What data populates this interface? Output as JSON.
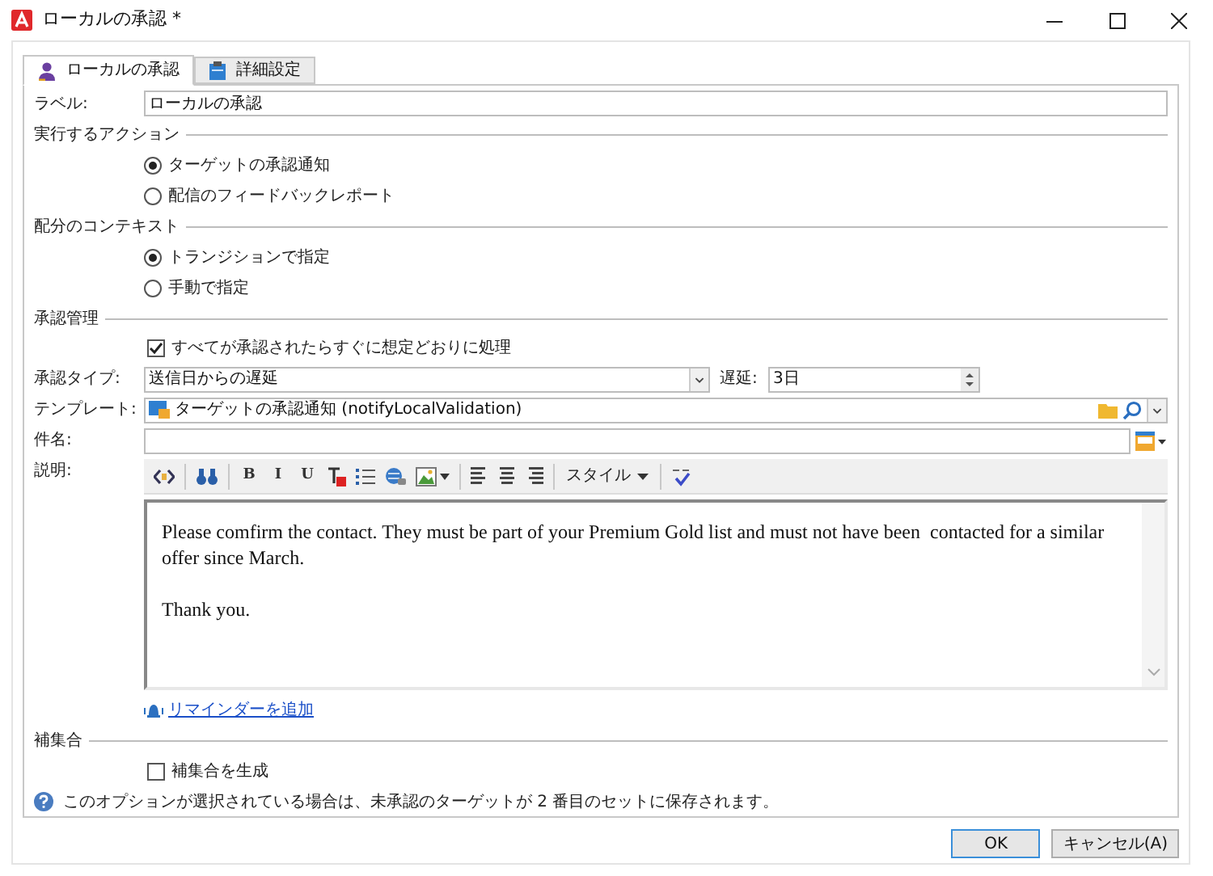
{
  "window": {
    "title": "ローカルの承認 *"
  },
  "tabs": [
    {
      "label": "ローカルの承認",
      "selected": true,
      "kind": "person"
    },
    {
      "label": "詳細設定",
      "selected": false,
      "kind": "clipboard"
    }
  ],
  "label_field": {
    "label": "ラベル:",
    "value": "ローカルの承認"
  },
  "action_section": {
    "title": "実行するアクション",
    "options": [
      {
        "label": "ターゲットの承認通知",
        "selected": true
      },
      {
        "label": "配信のフィードバックレポート",
        "selected": false
      }
    ]
  },
  "context_section": {
    "title": "配分のコンテキスト",
    "options": [
      {
        "label": "トランジションで指定",
        "selected": true
      },
      {
        "label": "手動で指定",
        "selected": false
      }
    ]
  },
  "approval_section": {
    "title": "承認管理",
    "auto_process": {
      "label": "すべてが承認されたらすぐに想定どおりに処理",
      "checked": true
    },
    "approval_type": {
      "label": "承認タイプ:",
      "value": "送信日からの遅延"
    },
    "delay": {
      "label": "遅延:",
      "value": "3日"
    },
    "template": {
      "label": "テンプレート:",
      "value": "ターゲットの承認通知 (notifyLocalValidation)"
    },
    "subject": {
      "label": "件名:"
    },
    "description": {
      "label": "説明:",
      "toolbar": [
        {
          "kind": "source"
        },
        {
          "kind": "separator"
        },
        {
          "kind": "find"
        },
        {
          "kind": "separator"
        },
        {
          "kind": "text",
          "text": "B"
        },
        {
          "kind": "text",
          "text": "I"
        },
        {
          "kind": "text",
          "text": "U"
        },
        {
          "kind": "clearformat"
        },
        {
          "kind": "list"
        },
        {
          "kind": "link"
        },
        {
          "kind": "image"
        },
        {
          "kind": "separator"
        },
        {
          "kind": "alignleft"
        },
        {
          "kind": "aligncenter"
        },
        {
          "kind": "alignright"
        },
        {
          "kind": "separator"
        },
        {
          "kind": "dropdown",
          "text": "スタイル"
        },
        {
          "kind": "separator"
        },
        {
          "kind": "spellcheck"
        }
      ],
      "paragraphs": [
        "Please comfirm the contact. They must be part of your Premium Gold list and must not have been  contacted for a similar offer since March.",
        "Thank you."
      ]
    },
    "reminder_link": "リマインダーを追加"
  },
  "complement_section": {
    "title": "補集合",
    "generate": {
      "label": "補集合を生成",
      "checked": false
    },
    "info": "このオプションが選択されている場合は、未承認のターゲットが 2 番目のセットに保存されます。"
  },
  "buttons": [
    {
      "label": "OK",
      "default": true
    },
    {
      "label": "キャンセル(A)",
      "default": false
    }
  ]
}
